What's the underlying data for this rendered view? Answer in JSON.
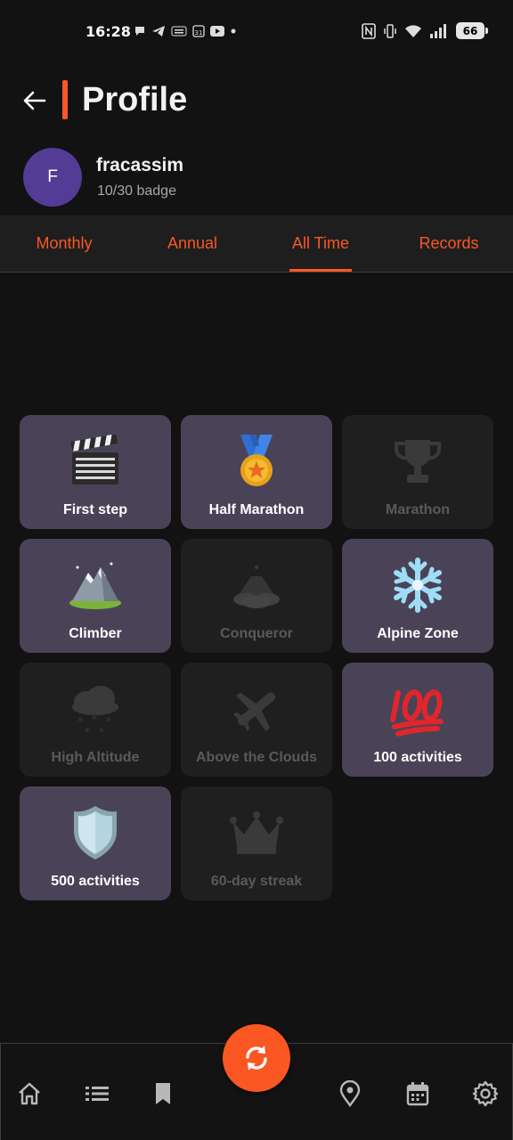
{
  "status_bar": {
    "time": "16:28",
    "battery": "66",
    "left_icons": [
      "chat-bubble-icon",
      "telegram-icon",
      "temu-icon",
      "calendar-31-icon",
      "youtube-icon",
      "dot-icon"
    ],
    "right_icons": [
      "nfc-icon",
      "vibrate-icon",
      "wifi-icon",
      "signal-icon",
      "battery-icon"
    ]
  },
  "header": {
    "title": "Profile",
    "accent_color": "#fb5722"
  },
  "user": {
    "avatar_letter": "F",
    "avatar_color": "#523c96",
    "name": "fracassim",
    "badge_progress": "10/30 badge"
  },
  "tabs": [
    {
      "label": "Monthly",
      "active": false
    },
    {
      "label": "Annual",
      "active": false
    },
    {
      "label": "All Time",
      "active": true
    },
    {
      "label": "Records",
      "active": false
    }
  ],
  "badges": [
    {
      "label": "First step",
      "icon": "clapperboard-icon",
      "earned": true
    },
    {
      "label": "Half Marathon",
      "icon": "medal-icon",
      "earned": true
    },
    {
      "label": "Marathon",
      "icon": "trophy-icon",
      "earned": false
    },
    {
      "label": "Climber",
      "icon": "mountain-icon",
      "earned": true
    },
    {
      "label": "Conqueror",
      "icon": "volcano-icon",
      "earned": false
    },
    {
      "label": "Alpine Zone",
      "icon": "snowflake-icon",
      "earned": true
    },
    {
      "label": "High Altitude",
      "icon": "snow-cloud-icon",
      "earned": false
    },
    {
      "label": "Above the Clouds",
      "icon": "airplane-icon",
      "earned": false
    },
    {
      "label": "100 activities",
      "icon": "hundred-points-icon",
      "earned": true
    },
    {
      "label": "500 activities",
      "icon": "shield-icon",
      "earned": true
    },
    {
      "label": "60-day streak",
      "icon": "crown-icon",
      "earned": false
    }
  ],
  "bottom_nav": {
    "items": [
      "home-icon",
      "list-icon",
      "bookmark-icon",
      "location-pin-icon",
      "calendar-icon",
      "settings-gear-icon"
    ],
    "fab_icon": "sync-icon"
  }
}
